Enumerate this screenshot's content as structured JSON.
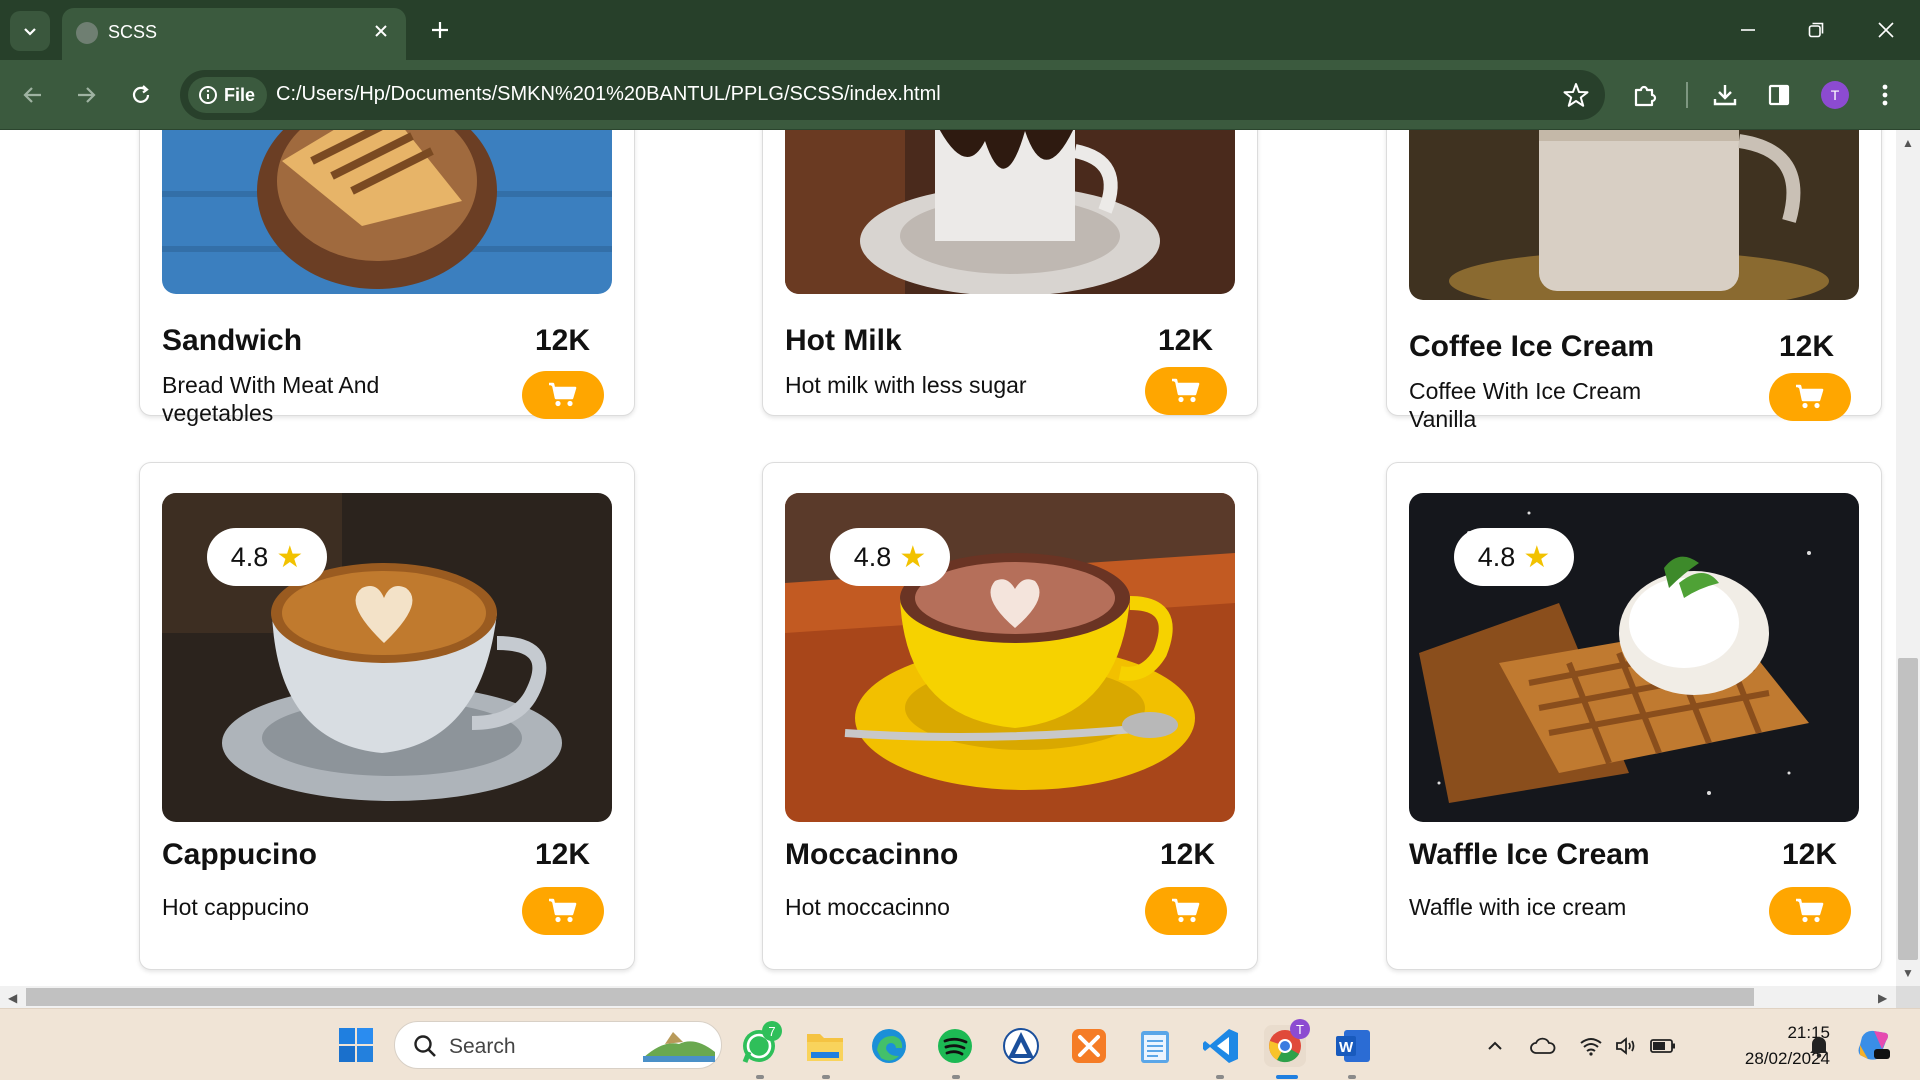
{
  "browser": {
    "tab_title": "SCSS",
    "site_chip_label": "File",
    "url": "C:/Users/Hp/Documents/SMKN%201%20BANTUL/PPLG/SCSS/index.html",
    "profile_initial": "T"
  },
  "menu": {
    "row1": [
      {
        "name": "Sandwich",
        "price": "12K",
        "description": "Bread With Meat And vegetables"
      },
      {
        "name": "Hot Milk",
        "price": "12K",
        "description": "Hot milk with less sugar"
      },
      {
        "name": "Coffee Ice Cream",
        "price": "12K",
        "description": "Coffee With Ice Cream Vanilla"
      }
    ],
    "row2": [
      {
        "name": "Cappucino",
        "price": "12K",
        "description": "Hot cappucino",
        "rating": "4.8"
      },
      {
        "name": "Moccacinno",
        "price": "12K",
        "description": "Hot moccacinno",
        "rating": "4.8"
      },
      {
        "name": "Waffle Ice Cream",
        "price": "12K",
        "description": "Waffle with ice cream",
        "rating": "4.8"
      }
    ]
  },
  "taskbar": {
    "search_placeholder": "Search",
    "whatsapp_badge": "7",
    "chrome_badge": "T",
    "time": "21:15",
    "date": "28/02/2024"
  },
  "colors": {
    "accent_orange": "#ffa600",
    "chrome_dark_green": "#27402a",
    "chrome_green": "#3b5a3e",
    "rating_star": "#f2c200"
  },
  "icons": {
    "cart_button": "shopping-cart-icon",
    "rating": "star-icon"
  }
}
